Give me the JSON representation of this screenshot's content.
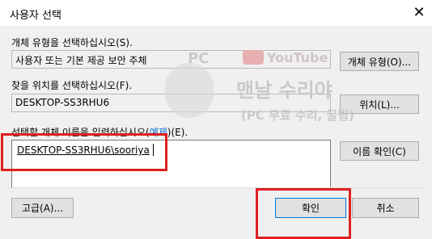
{
  "window": {
    "title": "사용자 선택",
    "close_glyph": "✕"
  },
  "object_type": {
    "label": "개체 유형을 선택하십시오(S).",
    "value": "사용자 또는 기본 제공 보안 주체",
    "button": "개체 유형(O)..."
  },
  "location": {
    "label": "찾을 위치를 선택하십시오(F).",
    "value": "DESKTOP-SS3RHU6",
    "button": "위치(L)..."
  },
  "object_names": {
    "label_prefix": "선택할 개체 이름을 입력하십시오(",
    "label_link": "예제",
    "label_suffix": ")(E).",
    "value": "DESKTOP-SS3RHU6\\sooriya",
    "check_button": "이름 확인(C)"
  },
  "footer": {
    "advanced": "고급(A)...",
    "ok": "확인",
    "cancel": "취소"
  },
  "watermark": {
    "pc": "PC",
    "youtube": "YouTube",
    "line1": "맨날 수리야",
    "line2": "(PC 무료 수리, 꿀팁)"
  },
  "highlight_color": "#e02020"
}
